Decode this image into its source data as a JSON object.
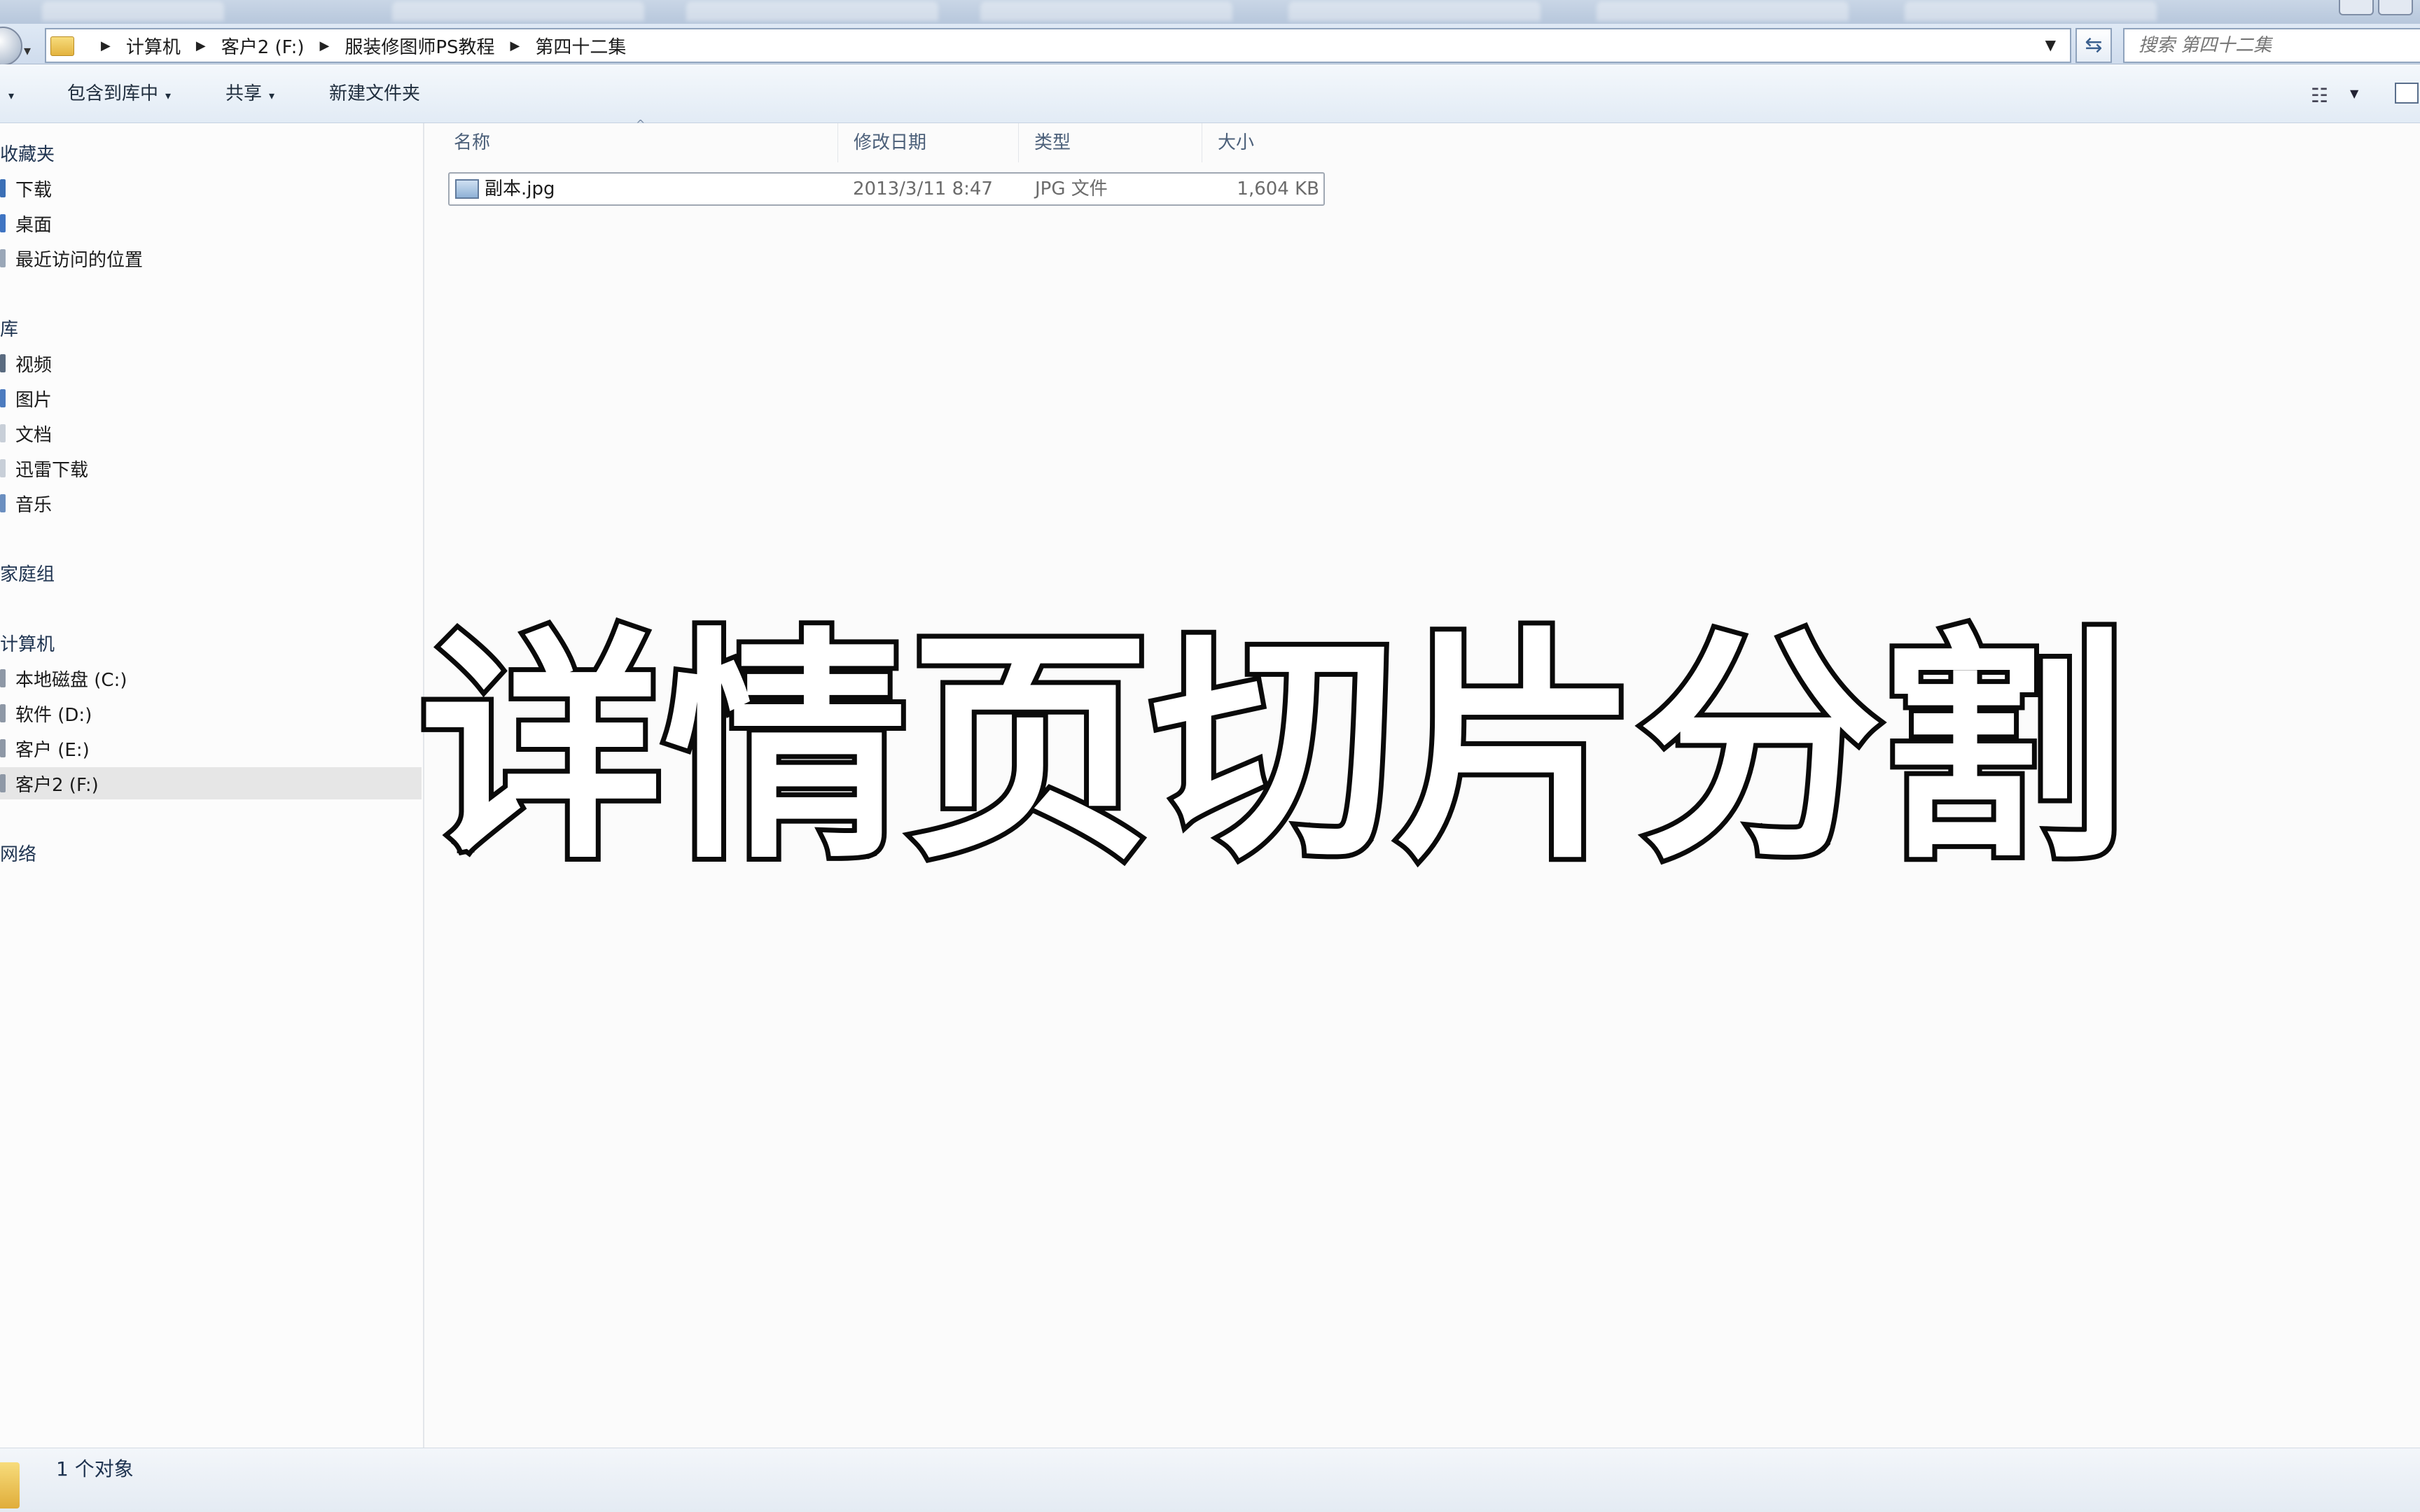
{
  "window": {
    "controls": [
      "minimize",
      "maximize"
    ]
  },
  "address": {
    "crumbs": [
      "计算机",
      "客户2 (F:)",
      "服装修图师PS教程",
      "第四十二集"
    ],
    "search_placeholder": "搜索 第四十二集"
  },
  "toolbar": {
    "organize_caret": "▾",
    "include_library": "包含到库中",
    "share": "共享",
    "new_folder": "新建文件夹",
    "caret": "▾"
  },
  "sidebar": {
    "favorites": {
      "title": "收藏夹",
      "items": [
        {
          "label": "下载",
          "color": "#3b6fb6"
        },
        {
          "label": "桌面",
          "color": "#3f74c2"
        },
        {
          "label": "最近访问的位置",
          "color": "#9aa7b8"
        }
      ]
    },
    "libraries": {
      "title": "库",
      "items": [
        {
          "label": "视频",
          "color": "#5a6b80"
        },
        {
          "label": "图片",
          "color": "#4c7bbf"
        },
        {
          "label": "文档",
          "color": "#c8cfd8"
        },
        {
          "label": "迅雷下载",
          "color": "#c8cfd8"
        },
        {
          "label": "音乐",
          "color": "#6b8fc0"
        }
      ]
    },
    "homegroup": {
      "title": "家庭组"
    },
    "computer": {
      "title": "计算机",
      "items": [
        {
          "label": "本地磁盘 (C:)",
          "color": "#8e98a6"
        },
        {
          "label": "软件 (D:)",
          "color": "#8e98a6"
        },
        {
          "label": "客户 (E:)",
          "color": "#8e98a6"
        },
        {
          "label": "客户2 (F:)",
          "color": "#8e98a6"
        }
      ]
    },
    "network": {
      "title": "网络"
    }
  },
  "file_list": {
    "columns": [
      "名称",
      "修改日期",
      "类型",
      "大小"
    ],
    "rows": [
      {
        "name": "副本.jpg",
        "date": "2013/3/11 8:47",
        "type": "JPG 文件",
        "size": "1,604 KB"
      }
    ]
  },
  "caption": "详情页切片分割",
  "status": {
    "text": "1 个对象"
  },
  "colors": {
    "selection": "#e6e6e6",
    "caption_fill": "#ffffff",
    "caption_stroke": "#0a0a0a"
  }
}
